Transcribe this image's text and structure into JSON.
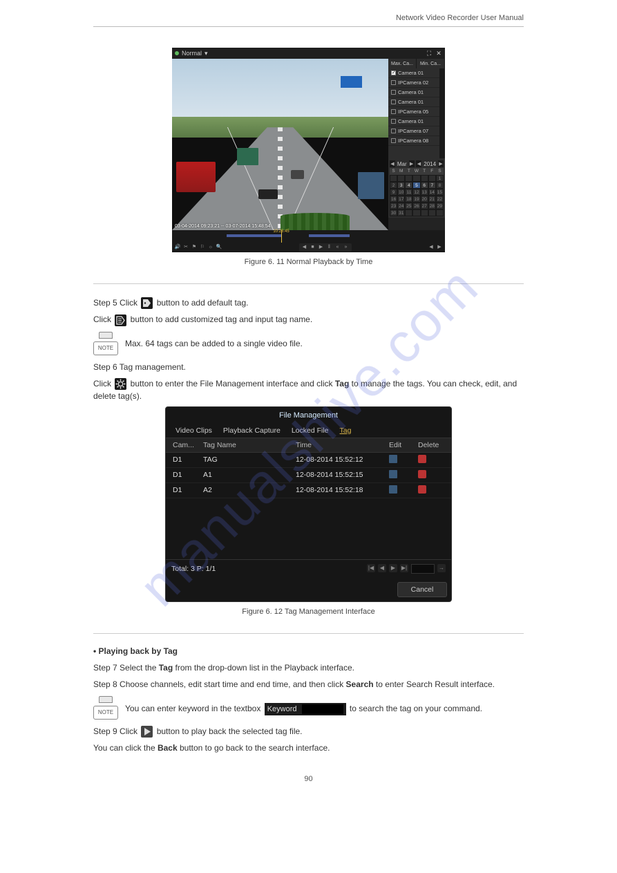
{
  "chapter_header": "Network Video Recorder User Manual",
  "figure6_11_caption": "Figure 6. 11 Normal Playback by Time",
  "step_heading_1": "Step 5 Click     button to add default tag.",
  "step_heading_2": "Click     button to add customized tag and input tag name.",
  "note_max_tags": "Max. 64 tags can be added to a single video file.",
  "step_heading_3": "Step 6 Tag management.",
  "step_tag_mgmt_text_before": "Click     button to enter the File Management interface and click ",
  "step_tag_mgmt_text_tag": "Tag",
  "step_tag_mgmt_text_after": " to manage the tags. You can check, edit, and delete tag(s).",
  "figure6_12_caption": "Figure 6. 12 Tag Management Interface",
  "section_heading": "• Playing back by Tag",
  "step7_text": "Step 7 Select the ",
  "step7_strong": "Tag",
  "step7_text_after": " from the drop-down list in the Playback interface.",
  "step8_text": "Step 8 Choose channels, edit start time and end time, and then click ",
  "step8_strong": "Search",
  "step8_text_after": " to enter Search Result interface.",
  "note_keyword_before": "You can enter keyword in the textbox ",
  "note_keyword_after": " to search the tag on your command.",
  "step9_text": "Step 9 Click     button to play back the selected tag file.",
  "step9_2_text": "You can click the ",
  "step9_2_strong": "Back",
  "step9_2_text_after": " button to go back to the search interface.",
  "keyword_label": "Keyword",
  "note_label": "NOTE",
  "playback": {
    "mode": "Normal",
    "tabs": {
      "max": "Max. Ca...",
      "min": "Min. Ca..."
    },
    "cameras": [
      {
        "label": "Camera 01",
        "checked": true
      },
      {
        "label": "IPCamera 02",
        "checked": false
      },
      {
        "label": "Camera 01",
        "checked": false
      },
      {
        "label": "Camera 01",
        "checked": false
      },
      {
        "label": "IPCamera 05",
        "checked": false
      },
      {
        "label": "Camera 01",
        "checked": false
      },
      {
        "label": "IPCamera 07",
        "checked": false
      },
      {
        "label": "IPCamera 08",
        "checked": false
      }
    ],
    "timestamp_overlay": "03-04-2014 09:23:21 -- 03-07-2014 15:48:54",
    "timeline_cursor": "10:26:45",
    "calendar": {
      "month_label": "Mar",
      "year_label": "2014",
      "weekdays": [
        "S",
        "M",
        "T",
        "W",
        "T",
        "F",
        "S"
      ],
      "rows": [
        [
          "",
          "",
          "",
          "",
          "",
          "",
          "1"
        ],
        [
          "2",
          "3",
          "4",
          "5",
          "6",
          "7",
          "8"
        ],
        [
          "9",
          "10",
          "11",
          "12",
          "13",
          "14",
          "15"
        ],
        [
          "16",
          "17",
          "18",
          "19",
          "20",
          "21",
          "22"
        ],
        [
          "23",
          "24",
          "25",
          "26",
          "27",
          "28",
          "29"
        ],
        [
          "30",
          "31",
          "",
          "",
          "",
          "",
          ""
        ]
      ],
      "recorded": [
        "3",
        "4",
        "5",
        "6",
        "7"
      ],
      "selected": "5"
    }
  },
  "file_mgmt": {
    "title": "File Management",
    "tabs": [
      "Video Clips",
      "Playback Capture",
      "Locked File",
      "Tag"
    ],
    "active_tab": "Tag",
    "columns": {
      "cam": "Cam...",
      "tag": "Tag Name",
      "time": "Time",
      "edit": "Edit",
      "delete": "Delete"
    },
    "rows": [
      {
        "cam": "D1",
        "tag": "TAG",
        "time": "12-08-2014 15:52:12"
      },
      {
        "cam": "D1",
        "tag": "A1",
        "time": "12-08-2014 15:52:15"
      },
      {
        "cam": "D1",
        "tag": "A2",
        "time": "12-08-2014 15:52:18"
      }
    ],
    "footer_total": "Total: 3 P: 1/1",
    "cancel": "Cancel"
  },
  "page_number": "90",
  "watermark": "manualshive.com"
}
